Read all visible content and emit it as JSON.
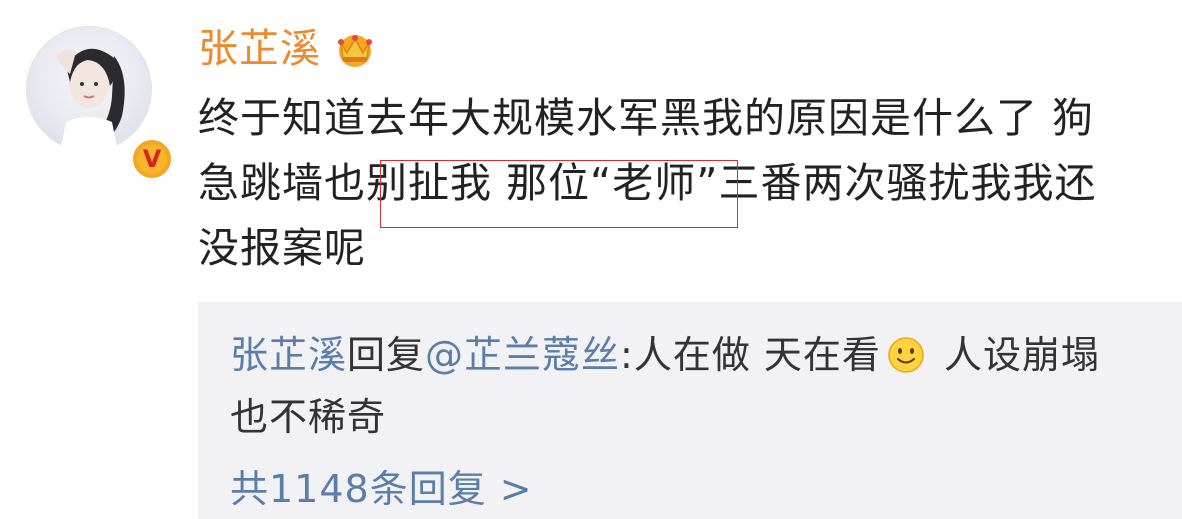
{
  "user": {
    "name": "张芷溪"
  },
  "post": {
    "line1": "终于知道去年大规模水军黑我的原因是什么了 狗",
    "line2_a": "急跳墙也",
    "line2_b": "别扯我 那位“老师”",
    "line2_c": "三番两次骚扰我我还",
    "line3": "没报案呢"
  },
  "reply": {
    "author": "张芷溪",
    "verb": "回复",
    "mention": "@芷兰蔻丝",
    "text_before_emoji": ":人在做 天在看",
    "text_after_emoji": " 人设崩塌",
    "text_line2": "也不稀奇",
    "count_label": "共1148条回复 >"
  },
  "colors": {
    "username": "#ee8a2c",
    "link": "#5b7ea8",
    "reply_bg": "#f2f2f5",
    "highlight_border": "#d23030"
  },
  "icons": {
    "crown": "crown-icon",
    "verified": "verified-v-icon",
    "emoji": "smile-icon"
  }
}
